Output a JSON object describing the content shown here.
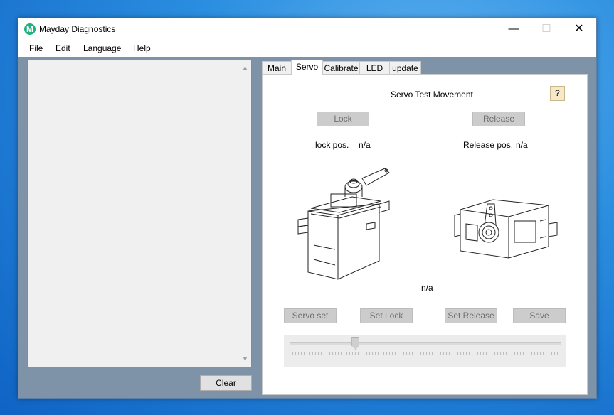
{
  "window": {
    "title": "Mayday Diagnostics",
    "icon_letter": "M"
  },
  "title_controls": {
    "minimize": "—",
    "maximize": "☐",
    "close": "✕"
  },
  "menu": [
    "File",
    "Edit",
    "Language",
    "Help"
  ],
  "left_panel": {
    "scroll_up": "▲",
    "scroll_down": "▼",
    "clear_label": "Clear"
  },
  "tabs": [
    "Main",
    "Servo",
    "Calibrate",
    "LED",
    "update"
  ],
  "active_tab": "Servo",
  "servo": {
    "heading": "Servo Test Movement",
    "help_label": "?",
    "lock_button": "Lock",
    "release_button": "Release",
    "lock_pos_label": "lock pos.",
    "lock_pos_value": "n/a",
    "release_pos_label": "Release pos.",
    "release_pos_value": "n/a",
    "center_value": "n/a",
    "servo_set": "Servo set",
    "set_lock": "Set Lock",
    "set_release": "Set Release",
    "save": "Save",
    "slider_position": 0.24
  }
}
